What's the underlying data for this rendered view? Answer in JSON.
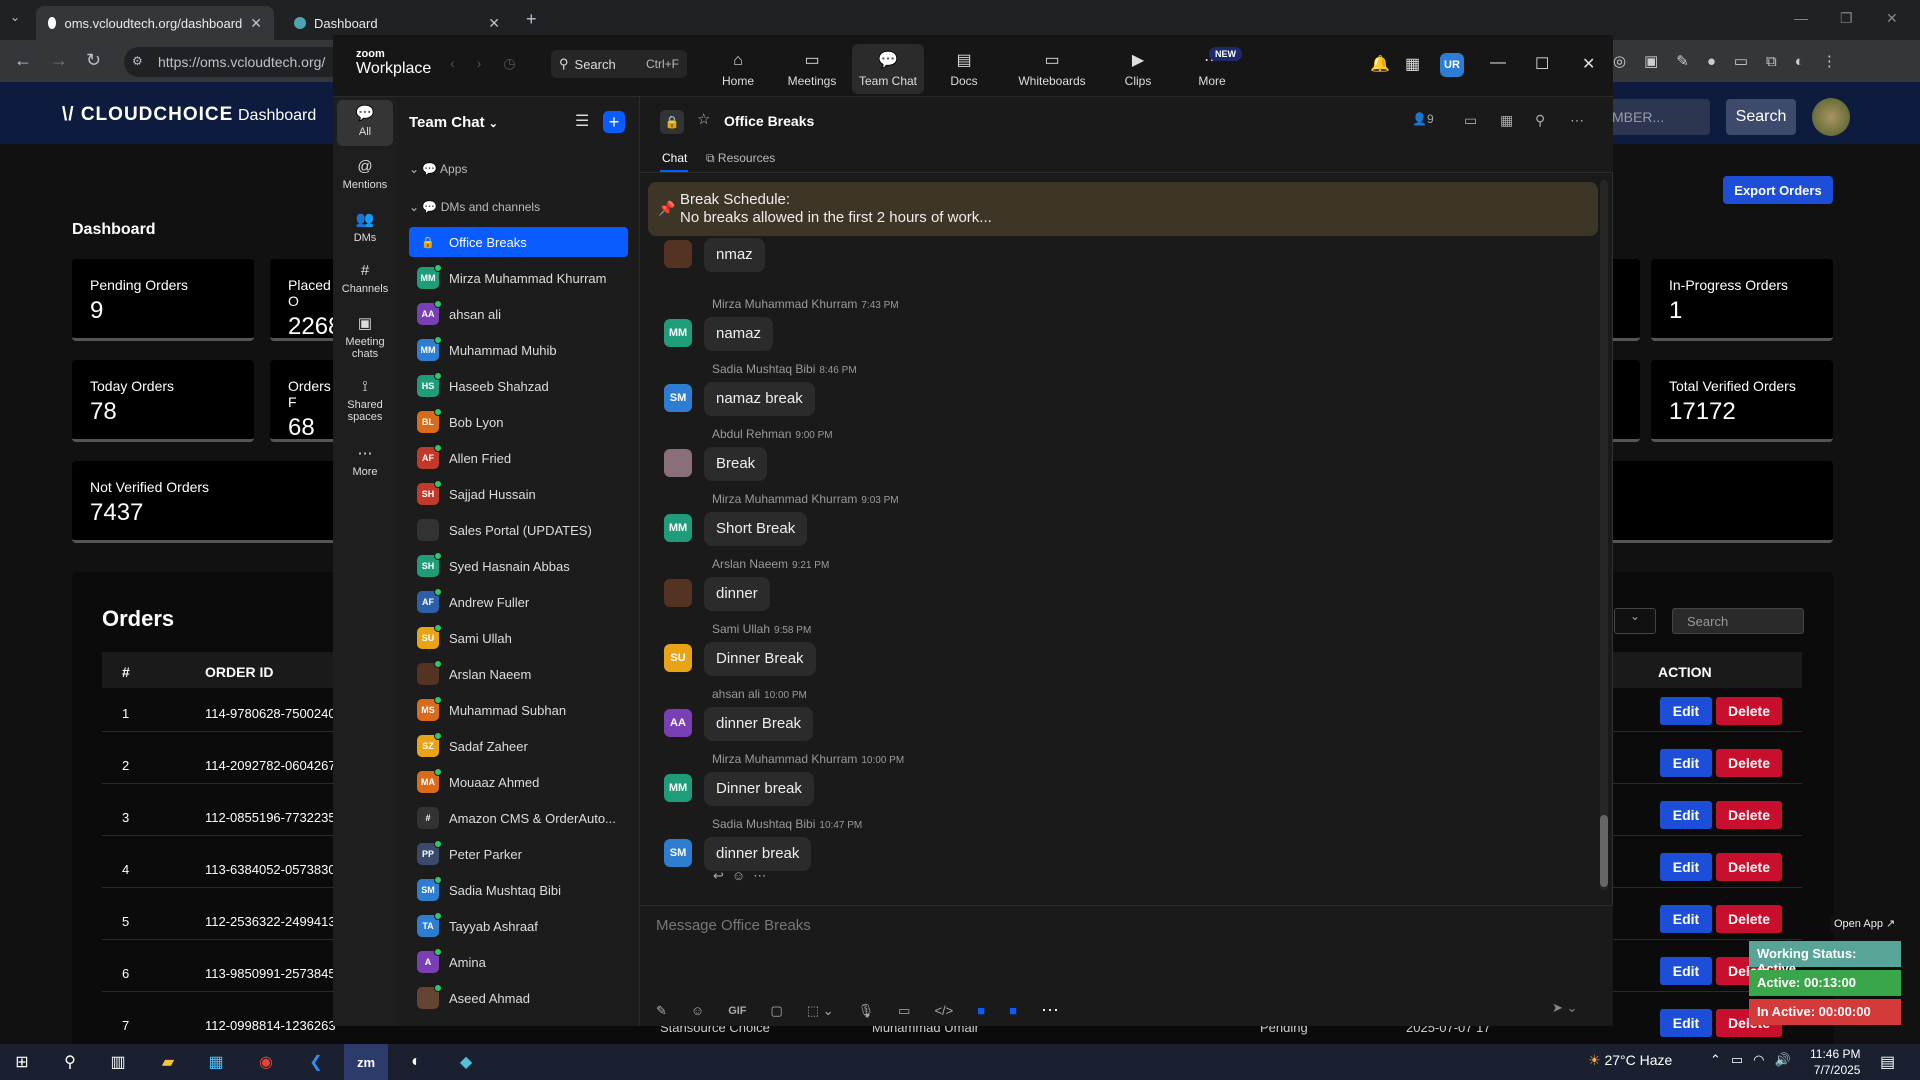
{
  "browser": {
    "tabs": [
      {
        "label": "oms.vcloudtech.org/dashboard"
      },
      {
        "label": "Dashboard"
      }
    ],
    "url": "https://oms.vcloudtech.org/"
  },
  "site": {
    "logo": "\\/ CLOUDCHOICE",
    "nav_dashboard": "Dashboard",
    "search_placeholder": "MBER...",
    "search_button": "Search",
    "page_title": "Dashboard",
    "export_button": "Export Orders",
    "cards": [
      {
        "label": "Pending Orders",
        "value": "9"
      },
      {
        "label": "Placed O",
        "value": "2268"
      },
      {
        "label": "In-Progress Orders",
        "value": "1"
      },
      {
        "label": "Today Orders",
        "value": "78"
      },
      {
        "label": "Orders F",
        "value": "68"
      },
      {
        "label": "Total Verified Orders",
        "value": "17172"
      },
      {
        "label": "Not Verified Orders",
        "value": "7437"
      }
    ],
    "orders": {
      "title": "Orders",
      "filter_search_placeholder": "Search",
      "headers": {
        "num": "#",
        "order_id": "ORDER ID",
        "action": "ACTION"
      },
      "rows": [
        {
          "n": "1",
          "id": "114-9780628-7500240"
        },
        {
          "n": "2",
          "id": "114-2092782-0604267"
        },
        {
          "n": "3",
          "id": "112-0855196-7732235"
        },
        {
          "n": "4",
          "id": "113-6384052-0573830"
        },
        {
          "n": "5",
          "id": "112-2536322-2499413"
        },
        {
          "n": "6",
          "id": "113-9850991-2573845"
        },
        {
          "n": "7",
          "id": "112-0998814-1236263"
        }
      ],
      "row7_extra": {
        "store": "Stansource Choice",
        "agent": "Muhammad Umair",
        "status": "Pending",
        "date": "2025-07-07 17"
      },
      "edit_label": "Edit",
      "delete_label": "Delete"
    }
  },
  "zoom": {
    "logo_top": "zoom",
    "logo_bottom": "Workplace",
    "search_label": "Search",
    "search_shortcut": "Ctrl+F",
    "nav": [
      {
        "label": "Home"
      },
      {
        "label": "Meetings"
      },
      {
        "label": "Team Chat"
      },
      {
        "label": "Docs"
      },
      {
        "label": "Whiteboards"
      },
      {
        "label": "Clips"
      },
      {
        "label": "More"
      }
    ],
    "new_badge": "NEW",
    "user_initials": "UR",
    "rail": [
      {
        "label": "All"
      },
      {
        "label": "Mentions"
      },
      {
        "label": "DMs"
      },
      {
        "label": "Channels"
      },
      {
        "label": "Meeting chats"
      },
      {
        "label": "Shared spaces"
      },
      {
        "label": "More"
      }
    ],
    "list_title": "Team Chat",
    "sections": {
      "apps": "Apps",
      "dms": "DMs and channels"
    },
    "contacts": [
      {
        "initials": "",
        "name": "Office Breaks",
        "color": "#0b5cff"
      },
      {
        "initials": "MM",
        "name": "Mirza Muhammad Khurram",
        "color": "#1f9d7a"
      },
      {
        "initials": "AA",
        "name": "ahsan ali",
        "color": "#7b3fb5"
      },
      {
        "initials": "MM",
        "name": "Muhammad Muhib",
        "color": "#2d7dd2"
      },
      {
        "initials": "HS",
        "name": "Haseeb Shahzad",
        "color": "#1f9d7a"
      },
      {
        "initials": "BL",
        "name": "Bob Lyon",
        "color": "#d96b1a"
      },
      {
        "initials": "AF",
        "name": "Allen Fried",
        "color": "#c0392b"
      },
      {
        "initials": "SH",
        "name": "Sajjad Hussain",
        "color": "#c0392b"
      },
      {
        "initials": "",
        "name": "Sales Portal (UPDATES)",
        "color": "#333"
      },
      {
        "initials": "SH",
        "name": "Syed Hasnain Abbas",
        "color": "#1f9d7a"
      },
      {
        "initials": "AF",
        "name": "Andrew Fuller",
        "color": "#2d5fa8"
      },
      {
        "initials": "SU",
        "name": "Sami Ullah",
        "color": "#e8a317"
      },
      {
        "initials": "",
        "name": "Arslan Naeem",
        "color": "#553322"
      },
      {
        "initials": "MS",
        "name": "Muhammad Subhan",
        "color": "#d96b1a"
      },
      {
        "initials": "SZ",
        "name": "Sadaf Zaheer",
        "color": "#e8a317"
      },
      {
        "initials": "MA",
        "name": "Mouaaz Ahmed",
        "color": "#d96b1a"
      },
      {
        "initials": "#",
        "name": "Amazon CMS & OrderAuto...",
        "color": "#333"
      },
      {
        "initials": "PP",
        "name": "Peter Parker",
        "color": "#3a4a6b"
      },
      {
        "initials": "SM",
        "name": "Sadia Mushtaq Bibi",
        "color": "#2d7dd2"
      },
      {
        "initials": "TA",
        "name": "Tayyab Ashraaf",
        "color": "#2d7dd2"
      },
      {
        "initials": "A",
        "name": "Amina",
        "color": "#7b3fb5"
      },
      {
        "initials": "",
        "name": "Aseed Ahmad",
        "color": "#664433"
      }
    ],
    "channel": {
      "name": "Office Breaks",
      "members": "9",
      "tabs": {
        "chat": "Chat",
        "resources": "Resources"
      },
      "pinned_title": "Break Schedule:",
      "pinned_text": "No breaks allowed in the first 2 hours of work...",
      "messages": [
        {
          "author": "",
          "time": "",
          "text": "nmaz",
          "initials": "",
          "color": "#553322"
        },
        {
          "author": "Mirza Muhammad Khurram",
          "time": "7:43 PM",
          "text": "namaz",
          "initials": "MM",
          "color": "#1f9d7a"
        },
        {
          "author": "Sadia Mushtaq Bibi",
          "time": "8:46 PM",
          "text": "namaz break",
          "initials": "SM",
          "color": "#2d7dd2"
        },
        {
          "author": "Abdul Rehman",
          "time": "9:00 PM",
          "text": "Break",
          "initials": "",
          "color": "#8a6f7a"
        },
        {
          "author": "Mirza Muhammad Khurram",
          "time": "9:03 PM",
          "text": "Short Break",
          "initials": "MM",
          "color": "#1f9d7a"
        },
        {
          "author": "Arslan Naeem",
          "time": "9:21 PM",
          "text": "dinner",
          "initials": "",
          "color": "#553322"
        },
        {
          "author": "Sami Ullah",
          "time": "9:58 PM",
          "text": "Dinner Break",
          "initials": "SU",
          "color": "#e8a317"
        },
        {
          "author": "ahsan ali",
          "time": "10:00 PM",
          "text": "dinner Break",
          "initials": "AA",
          "color": "#7b3fb5"
        },
        {
          "author": "Mirza Muhammad Khurram",
          "time": "10:00 PM",
          "text": "Dinner break",
          "initials": "MM",
          "color": "#1f9d7a"
        },
        {
          "author": "Sadia Mushtaq Bibi",
          "time": "10:47 PM",
          "text": "dinner break",
          "initials": "SM",
          "color": "#2d7dd2"
        }
      ],
      "compose_placeholder": "Message Office Breaks",
      "gif_label": "GIF"
    }
  },
  "widget": {
    "open_app": "Open App ↗",
    "status": "Working Status: Active",
    "active": "Active: 00:13:00",
    "inactive": "In Active: 00:00:00",
    "status_color": "#58a497",
    "active_color": "#3aa64a",
    "inactive_color": "#d43a3a"
  },
  "taskbar": {
    "weather": "27°C  Haze",
    "time": "11:46 PM",
    "date": "7/7/2025"
  }
}
